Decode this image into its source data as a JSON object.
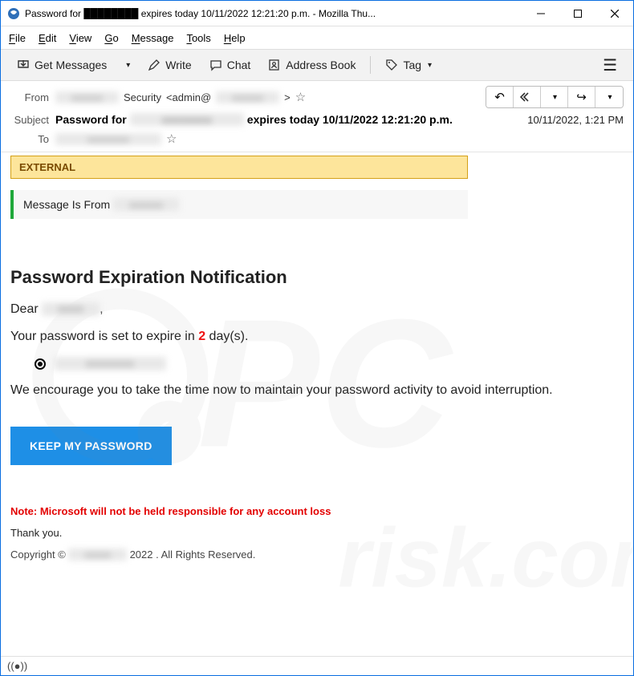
{
  "window": {
    "title": "Password for ████████ expires today 10/11/2022 12:21:20 p.m. - Mozilla Thu..."
  },
  "menu": {
    "file": "File",
    "edit": "Edit",
    "view": "View",
    "go": "Go",
    "message": "Message",
    "tools": "Tools",
    "help": "Help"
  },
  "toolbar": {
    "get_messages": "Get Messages",
    "write": "Write",
    "chat": "Chat",
    "address_book": "Address Book",
    "tag": "Tag"
  },
  "header": {
    "from_label": "From",
    "from_name": "████ Security <admin@████████>",
    "from_sec": "Security",
    "from_admin": "<admin@",
    "from_close": ">",
    "subject_label": "Subject",
    "subject": "Password for ████████ expires today 10/11/2022 12:21:20 p.m.",
    "subject_prefix": "Password for ",
    "subject_suffix": " expires today 10/11/2022 12:21:20 p.m.",
    "to_label": "To",
    "date": "10/11/2022, 1:21 PM"
  },
  "body": {
    "external": "EXTERNAL",
    "from_bar": "Message Is From ",
    "heading": "Password Expiration Notification",
    "dear": "Dear ",
    "dear_end": ",",
    "expire_pre": "Your password is set to expire in ",
    "days": "2",
    "expire_post": "  day(s).",
    "radio_value": "████████",
    "encourage": "We encourage you to take the time now to maintain your password activity to avoid interruption.",
    "cta": "KEEP MY PASSWORD",
    "note": "Note: Microsoft will not be held responsible for any account loss",
    "thank": "Thank you.",
    "copyright_pre": "Copyright © ",
    "copyright_post": " 2022 . All Rights Reserved."
  }
}
